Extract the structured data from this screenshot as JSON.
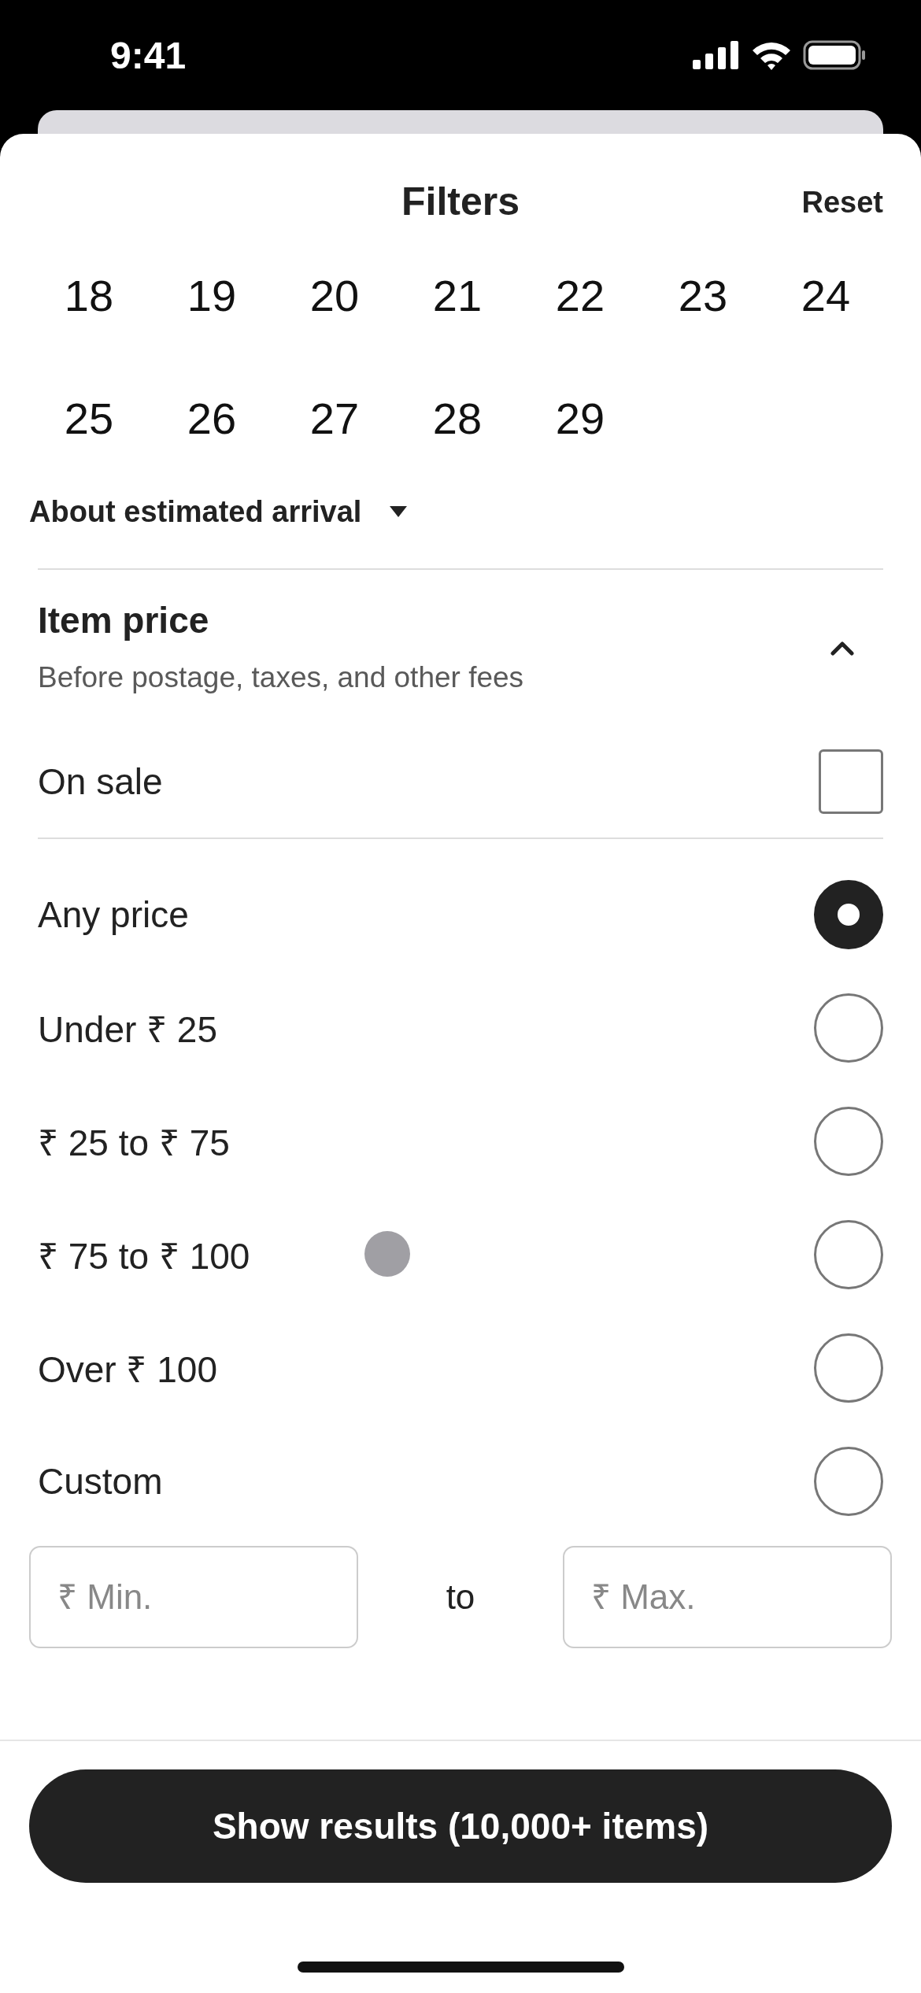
{
  "status_bar": {
    "time": "9:41"
  },
  "header": {
    "title": "Filters",
    "reset": "Reset"
  },
  "dates": [
    "18",
    "19",
    "20",
    "21",
    "22",
    "23",
    "24",
    "25",
    "26",
    "27",
    "28",
    "29"
  ],
  "arrival_link": "About estimated arrival",
  "price_section": {
    "title": "Item price",
    "subtitle": "Before postage, taxes, and other fees",
    "expanded": true
  },
  "on_sale": {
    "label": "On sale",
    "checked": false
  },
  "price_options": [
    {
      "label": "Any price",
      "selected": true
    },
    {
      "label": "Under ₹ 25",
      "selected": false
    },
    {
      "label": "₹ 25 to ₹ 75",
      "selected": false
    },
    {
      "label": "₹ 75 to ₹ 100",
      "selected": false
    },
    {
      "label": "Over ₹ 100",
      "selected": false
    },
    {
      "label": "Custom",
      "selected": false
    }
  ],
  "custom_range": {
    "min_placeholder": "₹ Min.",
    "separator": "to",
    "max_placeholder": "₹ Max."
  },
  "show_results": "Show results (10,000+ items)"
}
